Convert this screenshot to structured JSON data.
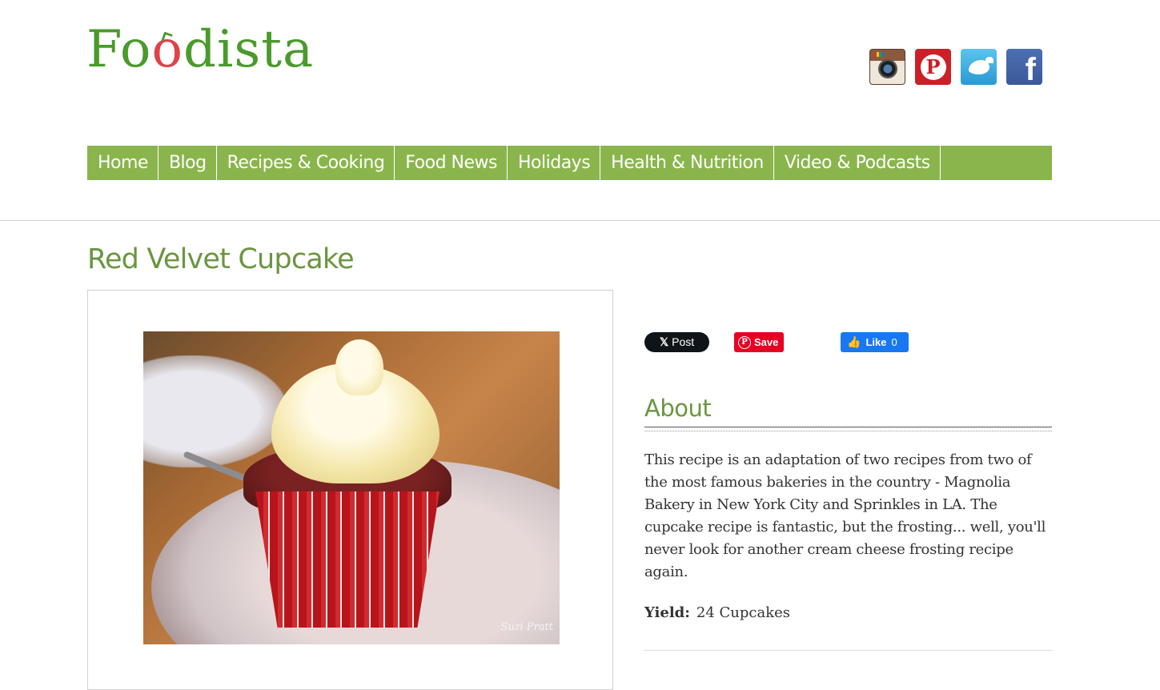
{
  "site": {
    "logo_text_before": "Fo",
    "logo_text_apple": "o",
    "logo_text_after": "dista",
    "brand_color": "#4a9a2c",
    "accent_color": "#e0424a"
  },
  "social": [
    {
      "name": "instagram-icon"
    },
    {
      "name": "pinterest-icon",
      "glyph": "P"
    },
    {
      "name": "twitter-icon"
    },
    {
      "name": "facebook-icon",
      "glyph": "f"
    }
  ],
  "nav": {
    "color": "#8ab54c",
    "items": [
      {
        "label": "Home"
      },
      {
        "label": "Blog"
      },
      {
        "label": "Recipes & Cooking"
      },
      {
        "label": "Food News"
      },
      {
        "label": "Holidays"
      },
      {
        "label": "Health & Nutrition"
      },
      {
        "label": "Video & Podcasts"
      }
    ]
  },
  "recipe": {
    "title": "Red Velvet Cupcake",
    "photo_signature": "Suzi Pratt",
    "about_heading": "About",
    "about_text": "This recipe is an adaptation of two recipes from two of the most famous bakeries in the country - Magnolia Bakery in New York City and Sprinkles in LA. The cupcake recipe is fantastic, but the frosting... well, you'll never look for another cream cheese frosting recipe again.",
    "yield_label": "Yield:",
    "yield_value": "24 Cupcakes"
  },
  "share": {
    "post_x": "𝕏",
    "post_label": "Post",
    "save_label": "Save",
    "like_label": "Like",
    "like_count": "0"
  }
}
